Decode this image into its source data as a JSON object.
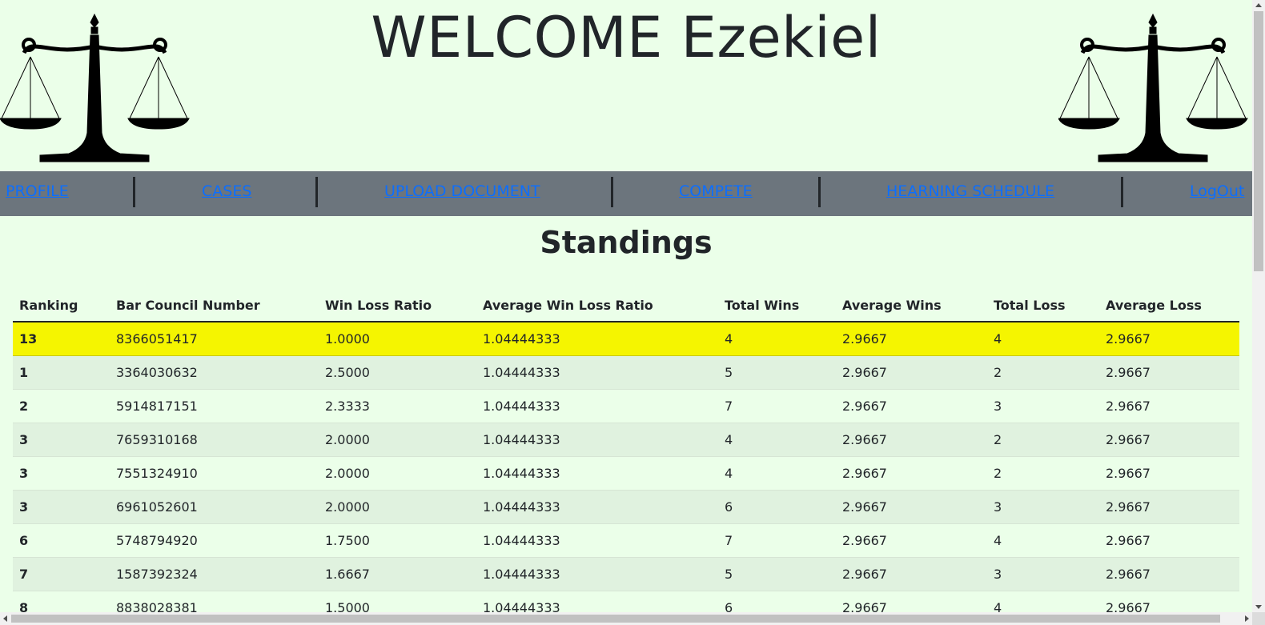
{
  "header": {
    "welcome": "WELCOME Ezekiel",
    "logo_icon": "scales-of-justice-icon"
  },
  "nav": {
    "items": [
      {
        "label": "PROFILE"
      },
      {
        "label": "CASES"
      },
      {
        "label": "UPLOAD DOCUMENT"
      },
      {
        "label": "COMPETE"
      },
      {
        "label": "HEARNING SCHEDULE"
      },
      {
        "label": "LogOut"
      }
    ],
    "link_color": "#0d6efd",
    "bar_color": "#6c757d"
  },
  "page": {
    "title": "Standings",
    "background": "#ebffe9",
    "highlight_color": "#f5f500"
  },
  "table": {
    "headers": [
      "Ranking",
      "Bar Council Number",
      "Win Loss Ratio",
      "Average Win Loss Ratio",
      "Total Wins",
      "Average Wins",
      "Total Loss",
      "Average Loss"
    ],
    "rows": [
      [
        "13",
        "8366051417",
        "1.0000",
        "1.04444333",
        "4",
        "2.9667",
        "4",
        "2.9667"
      ],
      [
        "1",
        "3364030632",
        "2.5000",
        "1.04444333",
        "5",
        "2.9667",
        "2",
        "2.9667"
      ],
      [
        "2",
        "5914817151",
        "2.3333",
        "1.04444333",
        "7",
        "2.9667",
        "3",
        "2.9667"
      ],
      [
        "3",
        "7659310168",
        "2.0000",
        "1.04444333",
        "4",
        "2.9667",
        "2",
        "2.9667"
      ],
      [
        "3",
        "7551324910",
        "2.0000",
        "1.04444333",
        "4",
        "2.9667",
        "2",
        "2.9667"
      ],
      [
        "3",
        "6961052601",
        "2.0000",
        "1.04444333",
        "6",
        "2.9667",
        "3",
        "2.9667"
      ],
      [
        "6",
        "5748794920",
        "1.7500",
        "1.04444333",
        "7",
        "2.9667",
        "4",
        "2.9667"
      ],
      [
        "7",
        "1587392324",
        "1.6667",
        "1.04444333",
        "5",
        "2.9667",
        "3",
        "2.9667"
      ],
      [
        "8",
        "8838028381",
        "1.5000",
        "1.04444333",
        "6",
        "2.9667",
        "4",
        "2.9667"
      ]
    ]
  }
}
